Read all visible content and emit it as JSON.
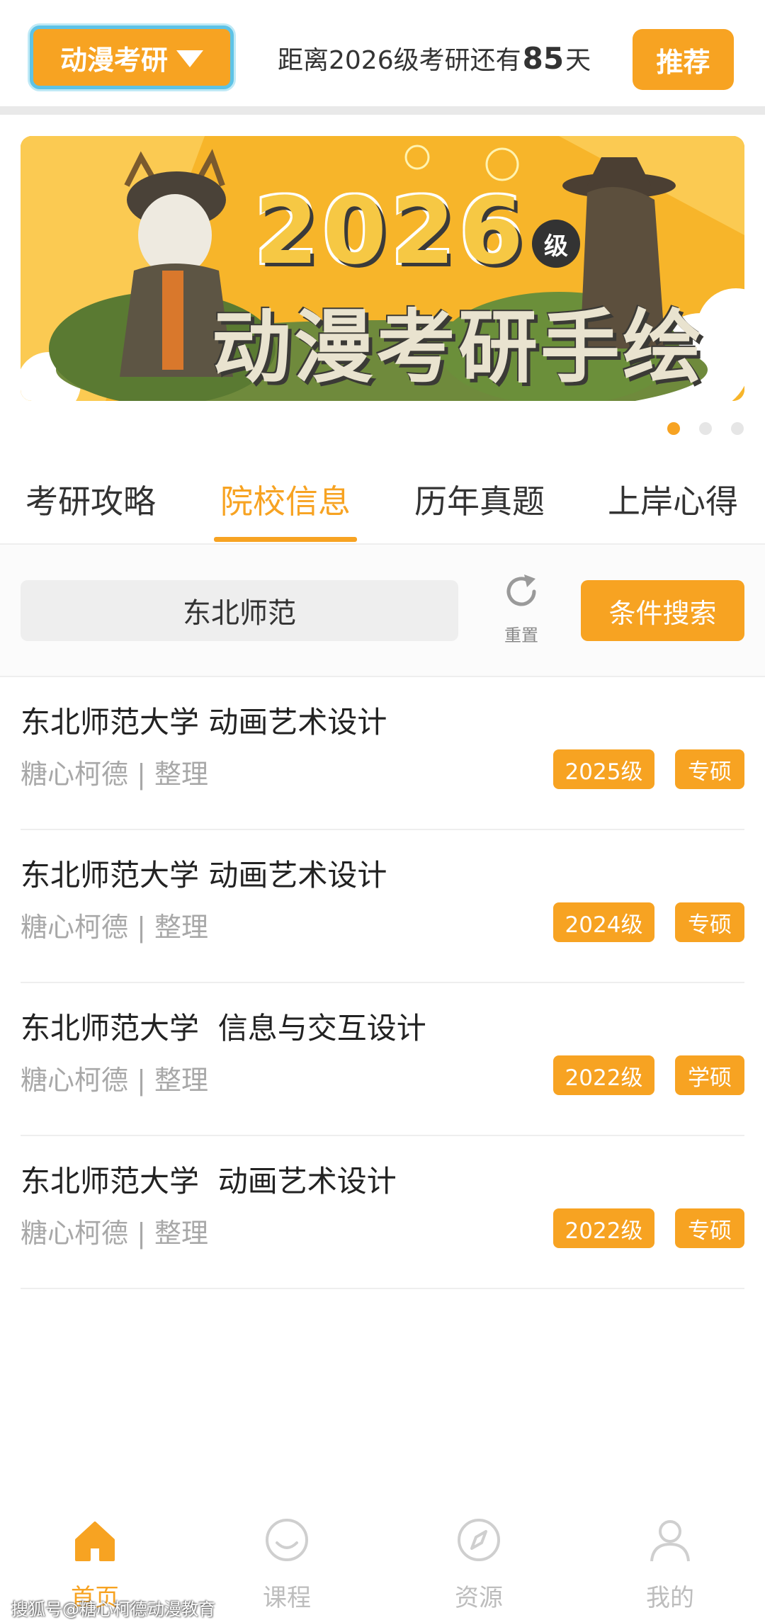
{
  "header": {
    "channel_label": "动漫考研",
    "countdown_prefix": "距离2026级考研还有",
    "countdown_days": "85",
    "countdown_suffix": "天",
    "recommend_label": "推荐"
  },
  "banner": {
    "year": "2026",
    "grade_badge": "级",
    "title": "动漫考研手绘",
    "page_count": 3,
    "active_page": 1
  },
  "tabs": [
    {
      "label": "考研攻略"
    },
    {
      "label": "院校信息"
    },
    {
      "label": "历年真题"
    },
    {
      "label": "上岸心得"
    }
  ],
  "active_tab": "院校信息",
  "filter": {
    "school_value": "东北师范",
    "reset_label": "重置",
    "search_button_label": "条件搜索"
  },
  "list": [
    {
      "title": "东北师范大学 动画艺术设计",
      "author": "糖心柯德",
      "action": "整理",
      "year": "2025级",
      "type": "专硕"
    },
    {
      "title": "东北师范大学 动画艺术设计",
      "author": "糖心柯德",
      "action": "整理",
      "year": "2024级",
      "type": "专硕"
    },
    {
      "title": "东北师范大学  信息与交互设计",
      "author": "糖心柯德",
      "action": "整理",
      "year": "2022级",
      "type": "学硕"
    },
    {
      "title": "东北师范大学  动画艺术设计",
      "author": "糖心柯德",
      "action": "整理",
      "year": "2022级",
      "type": "专硕"
    }
  ],
  "meta_separator": "|",
  "bottom_nav": [
    {
      "label": "首页",
      "icon": "home-icon",
      "active": true
    },
    {
      "label": "课程",
      "icon": "smile-icon",
      "active": false
    },
    {
      "label": "资源",
      "icon": "compass-icon",
      "active": false
    },
    {
      "label": "我的",
      "icon": "user-icon",
      "active": false
    }
  ],
  "watermark": "搜狐号@糖心柯德动漫教育",
  "colors": {
    "accent": "#f7a322",
    "channel_border": "#5ec3e6",
    "muted_text": "#a8a8a8",
    "inactive_nav": "#bdbdbd"
  }
}
